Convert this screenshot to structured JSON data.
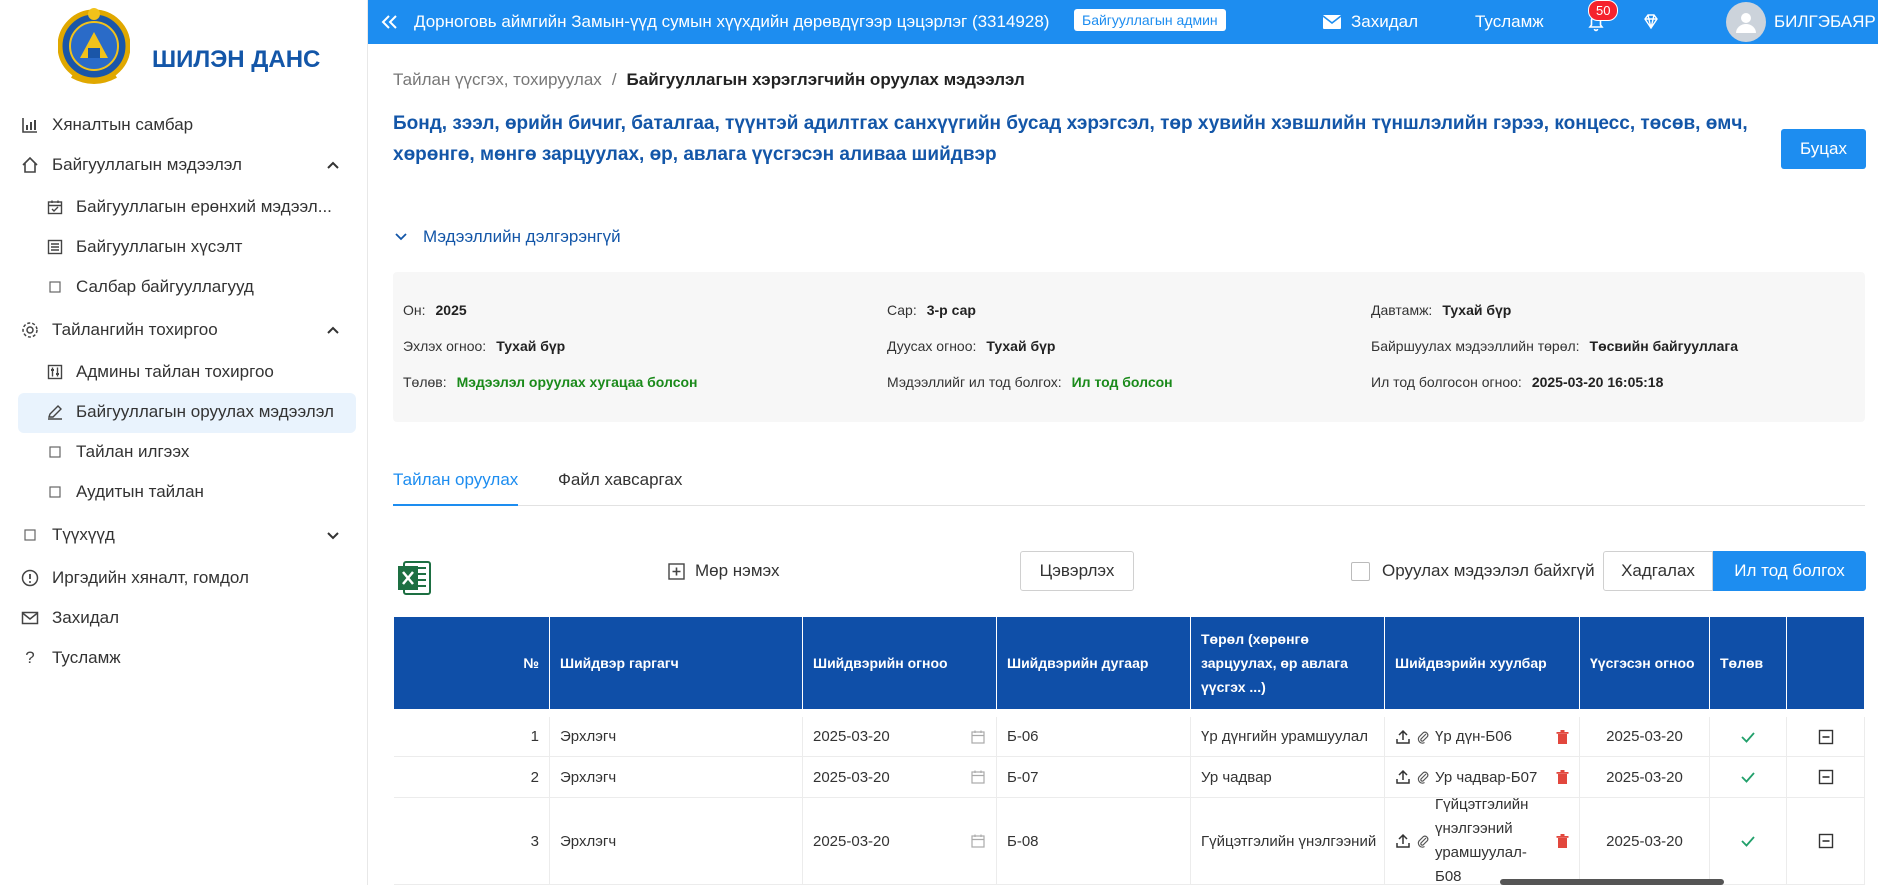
{
  "app": {
    "name": "ШИЛЭН ДАНС"
  },
  "sidebar": {
    "items": [
      {
        "label": "Хяналтын самбар",
        "icon": "bar-chart-icon"
      },
      {
        "label": "Байгууллагын мэдээлэл",
        "icon": "home-icon",
        "expanded": true
      },
      {
        "label": "Байгууллагын ерөнхий мэдээл...",
        "icon": "calendar-check-icon"
      },
      {
        "label": "Байгууллагын хүсэлт",
        "icon": "list-icon"
      },
      {
        "label": "Салбар байгууллагууд",
        "icon": "square-icon"
      },
      {
        "label": "Тайлангийн тохиргоо",
        "icon": "gear-icon",
        "expanded": true
      },
      {
        "label": "Админы тайлан тохиргоо",
        "icon": "sliders-icon"
      },
      {
        "label": "Байгууллагын оруулах мэдээлэл",
        "icon": "edit-icon",
        "active": true
      },
      {
        "label": "Тайлан илгээх",
        "icon": "square-icon"
      },
      {
        "label": "Аудитын тайлан",
        "icon": "square-icon"
      },
      {
        "label": "Түүхүүд",
        "icon": "square-icon",
        "expanded": false
      },
      {
        "label": "Иргэдийн хяналт, гомдол",
        "icon": "info-icon"
      },
      {
        "label": "Захидал",
        "icon": "mail-icon"
      },
      {
        "label": "Тусламж",
        "icon": "question-icon"
      }
    ]
  },
  "topbar": {
    "org": "Дорноговь аймгийн Замын-үүд сумын хүүхдийн дөрөвдүгээр цэцэрлэг (3314928)",
    "role": "Байгууллагын админ",
    "mail": "Захидал",
    "help": "Тусламж",
    "notifications": "50",
    "user": "БИЛГЭБАЯР"
  },
  "breadcrumb": {
    "parent": "Тайлан үүсгэх, тохируулах",
    "separator": "/",
    "current": "Байгууллагын хэрэглэгчийн оруулах мэдээлэл"
  },
  "page": {
    "title": "Бонд, зээл, өрийн бичиг, баталгаа, түүнтэй адилтгах санхүүгийн бусад хэрэгсэл, төр хувийн хэвшлийн түншлэлийн гэрээ, концесс, төсөв, өмч, хөрөнгө, мөнгө зарцуулах, өр, авлага үүсгэсэн аливаа шийдвэр",
    "back": "Буцах",
    "details_toggle": "Мэдээллийн дэлгэрэнгүй"
  },
  "details": {
    "year_label": "Он:",
    "year": "2025",
    "month_label": "Сар:",
    "month": "3-р сар",
    "freq_label": "Давтамж:",
    "freq": "Тухай бүр",
    "start_label": "Эхлэх огноо:",
    "start": "Тухай бүр",
    "end_label": "Дуусах огноо:",
    "end": "Тухай бүр",
    "type_label": "Байршуулах мэдээллийн төрөл:",
    "type": "Төсвийн байгууллага",
    "status_label": "Төлөв:",
    "status": "Мэдээлэл оруулах хугацаа болсон",
    "public_label": "Мэдээллийг ил тод болгох:",
    "public": "Ил тод болсон",
    "public_date_label": "Ил тод болгосон огноо:",
    "public_date": "2025-03-20 16:05:18",
    "green": "#1a8a1a"
  },
  "tabs": [
    "Тайлан оруулах",
    "Файл хавсаргах"
  ],
  "toolbar": {
    "add_row": "Мөр нэмэх",
    "clear": "Цэвэрлэх",
    "no_data": "Оруулах мэдээлэл байхгүй",
    "save": "Хадгалах",
    "publish": "Ил тод болгох"
  },
  "table": {
    "columns": [
      "№",
      "Шийдвэр гаргагч",
      "Шийдвэрийн огноо",
      "Шийдвэрийн дугаар",
      "Төрөл (хөрөнгө зарцуулах, өр авлага үүсгэх ...)",
      "Шийдвэрийн хуулбар",
      "Үүсгэсэн огноо",
      "Төлөв",
      ""
    ],
    "rows": [
      {
        "no": "1",
        "maker": "Эрхлэгч",
        "date": "2025-03-20",
        "number": "Б-06",
        "type": "Үр дүнгийн урамшуулал",
        "file": "Үр дүн-Б06",
        "created": "2025-03-20"
      },
      {
        "no": "2",
        "maker": "Эрхлэгч",
        "date": "2025-03-20",
        "number": "Б-07",
        "type": "Ур чадвар",
        "file": "Ур чадвар-Б07",
        "created": "2025-03-20"
      },
      {
        "no": "3",
        "maker": "Эрхлэгч",
        "date": "2025-03-20",
        "number": "Б-08",
        "type": "Гүйцэтгэлийн үнэлгээний",
        "file": "Гүйцэтгэлийн үнэлгээний урамшуулал-Б08",
        "created": "2025-03-20"
      }
    ]
  },
  "colors": {
    "primary": "#1d8df0",
    "header": "#0f4fa8",
    "brand": "#1356a8",
    "delete": "#e2473d",
    "check": "#22a06b"
  }
}
